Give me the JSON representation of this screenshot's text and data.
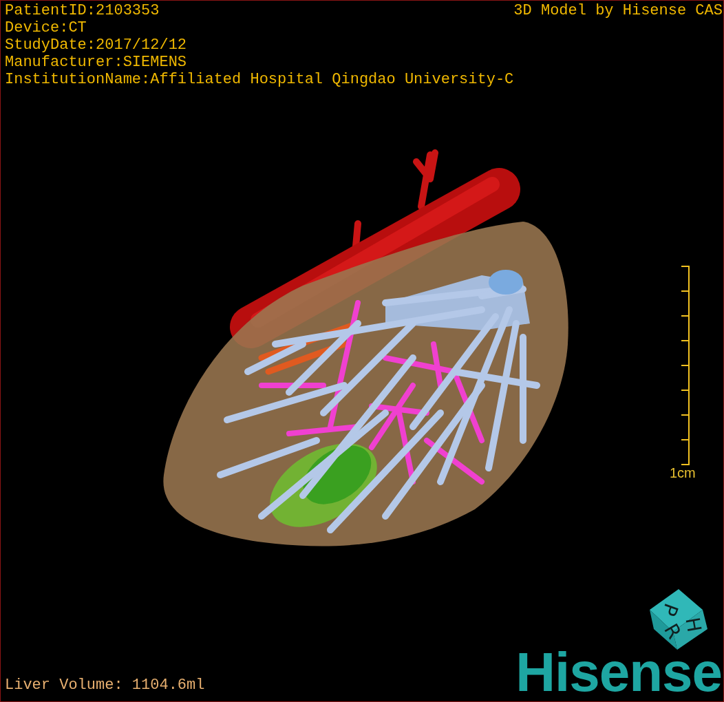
{
  "info_lines": [
    "PatientID:2103353",
    "Device:CT",
    "StudyDate:2017/12/12",
    "Manufacturer:SIEMENS",
    "InstitutionName:Affiliated Hospital Qingdao University-C"
  ],
  "model_credit": "3D Model by Hisense CAS",
  "scale_bar": {
    "label": "1cm"
  },
  "orientation_cube": {
    "faces": [
      "P",
      "R",
      "H"
    ]
  },
  "logo": "Hisense",
  "liver_volume": "Liver Volume: 1104.6ml"
}
